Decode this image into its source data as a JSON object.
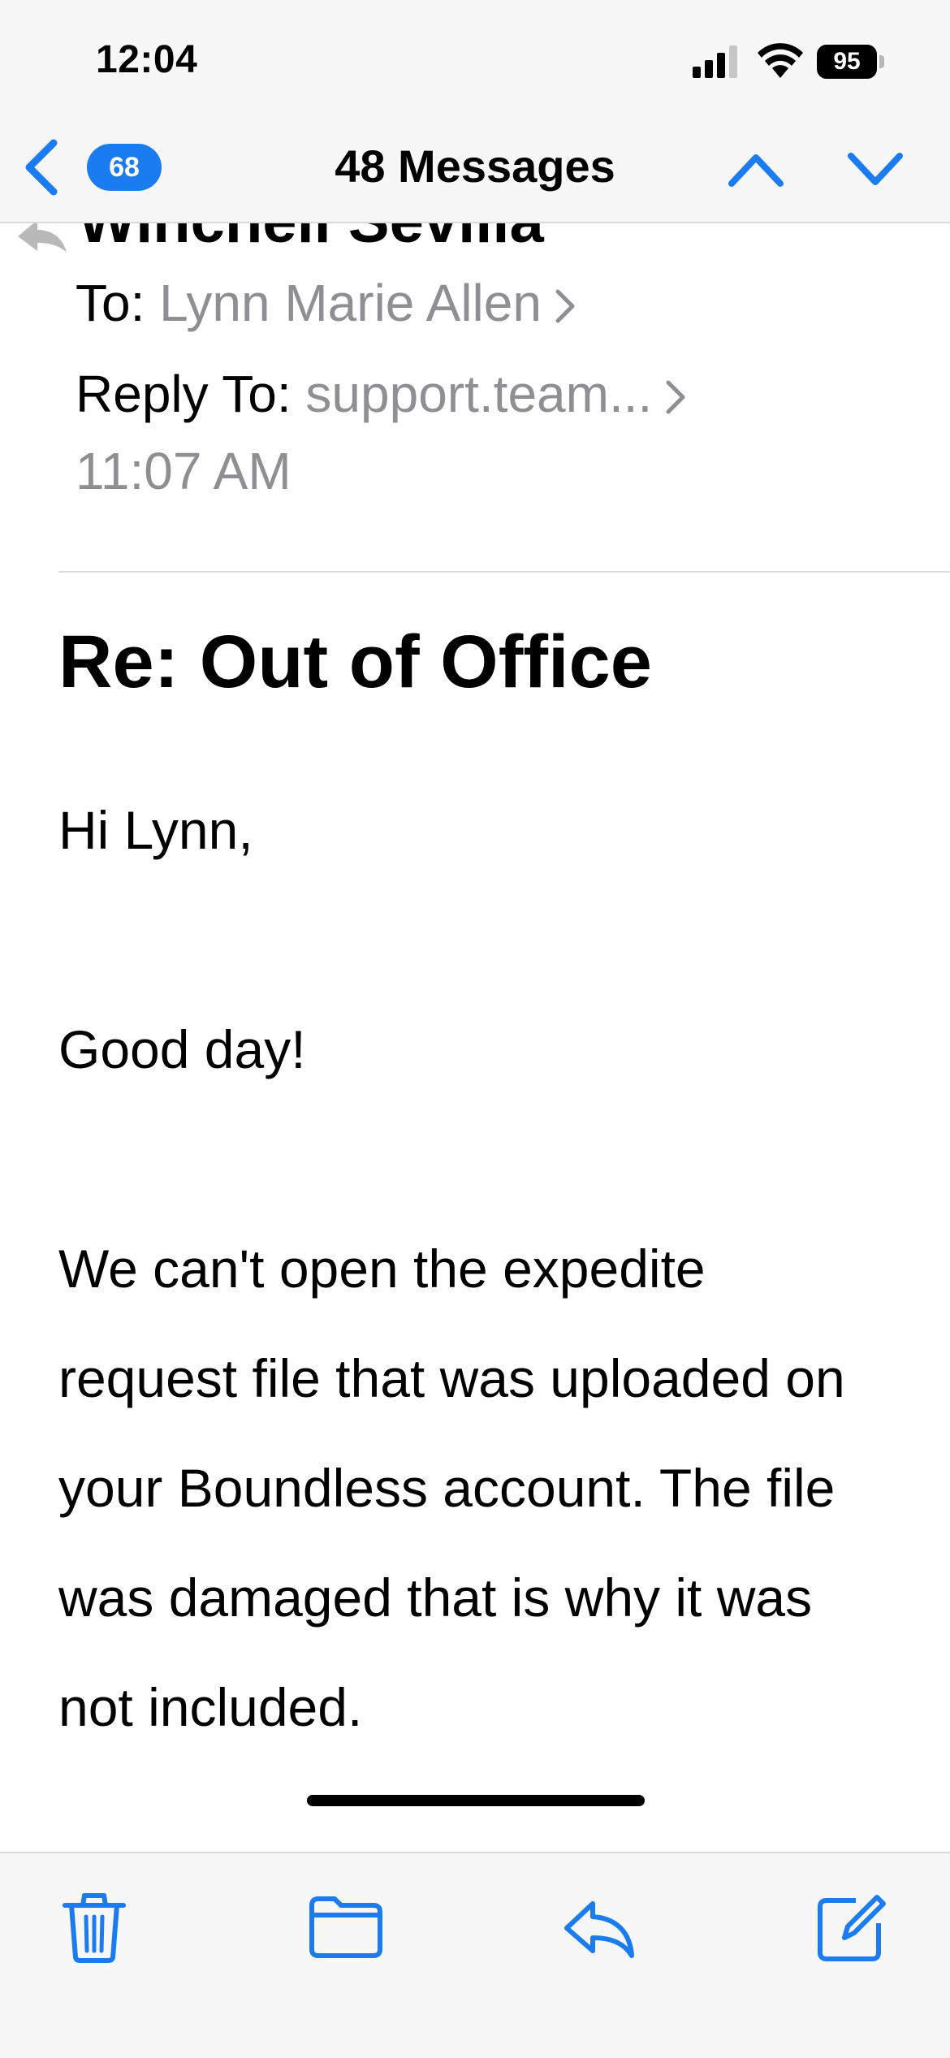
{
  "status_bar": {
    "time": "12:04",
    "battery_level": "95",
    "icons": [
      "cellular-signal-icon",
      "wifi-icon",
      "battery-icon"
    ]
  },
  "nav": {
    "unread_count": "68",
    "title": "48 Messages",
    "icons": [
      "back-chevron-icon",
      "previous-message-chevron-up-icon",
      "next-message-chevron-down-icon"
    ]
  },
  "email": {
    "sender_name": "Winchell Sevilla",
    "to_label": "To:",
    "to_value": "Lynn Marie Allen",
    "reply_to_label": "Reply To:",
    "reply_to_value": "support.team...",
    "time": "11:07 AM",
    "subject": "Re: Out of Office",
    "body": {
      "greeting": "Hi Lynn,",
      "line2": "Good day!",
      "paragraph": "We can't open the expedite request file that was uploaded on your Boundless account. The file was damaged  that is why it was not included."
    }
  },
  "toolbar": {
    "icons": [
      "trash-icon",
      "folder-icon",
      "reply-icon",
      "compose-icon"
    ]
  },
  "colors": {
    "accent": "#1a7cf0",
    "secondary_text": "#8e8e93",
    "bar_background": "#f7f7f7"
  }
}
